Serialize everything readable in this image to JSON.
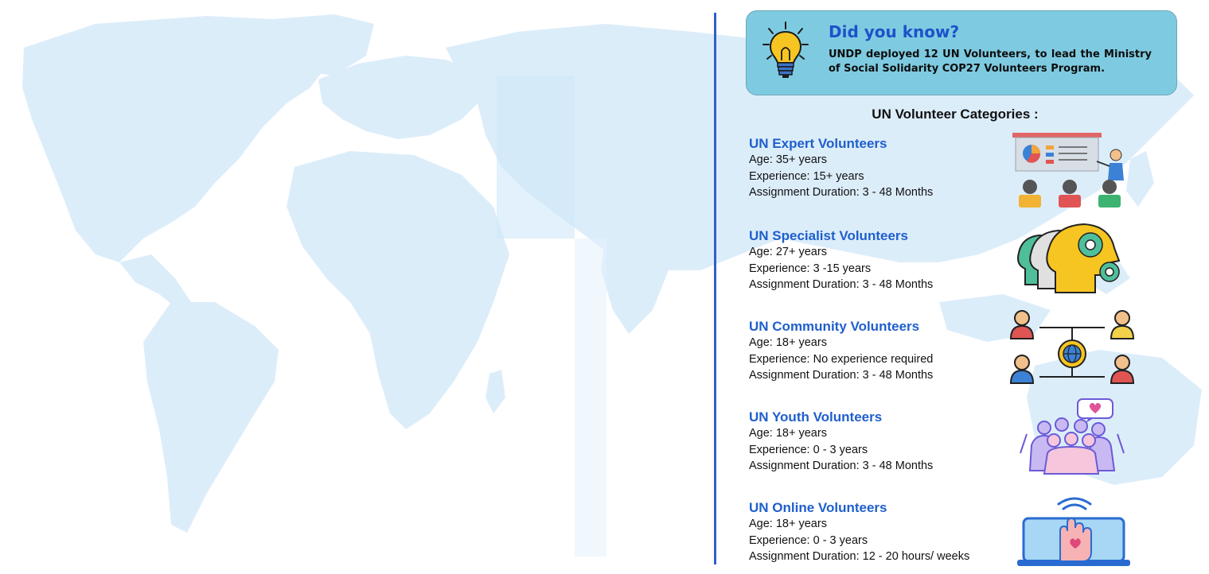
{
  "info_card": {
    "title": "Did you know?",
    "text": "UNDP deployed 12 UN Volunteers, to lead the Ministry of Social Solidarity COP27 Volunteers Program.",
    "icon": "lightbulb-icon"
  },
  "categories_heading": "UN Volunteer Categories :",
  "categories": [
    {
      "title": "UN Expert Volunteers",
      "age": "Age: 35+ years",
      "experience": "Experience:  15+ years",
      "duration": "Assignment Duration:  3 - 48 Months",
      "icon": "presentation-icon"
    },
    {
      "title": "UN Specialist Volunteers",
      "age": "Age: 27+ years",
      "experience": "Experience: 3 -15 years",
      "duration": "Assignment Duration:  3 - 48 Months",
      "icon": "heads-gears-icon"
    },
    {
      "title": "UN Community Volunteers",
      "age": "Age: 18+ years",
      "experience": "Experience: No experience required",
      "duration": "Assignment Duration:  3 - 48 Months",
      "icon": "global-network-icon"
    },
    {
      "title": "UN Youth Volunteers",
      "age": "Age: 18+ years",
      "experience": "Experience: 0 - 3 years",
      "duration": "Assignment Duration: 3 - 48 Months",
      "icon": "youth-group-heart-icon"
    },
    {
      "title": "UN Online Volunteers",
      "age": "Age: 18+ years",
      "experience": "Experience: 0 - 3 years",
      "duration": "Assignment Duration: 12 - 20 hours/ weeks",
      "icon": "laptop-hand-icon"
    }
  ],
  "colors": {
    "accent_blue": "#1f5fcc",
    "card_bg": "#7ecbe1",
    "map_fill": "#dbeefb",
    "divider": "#2f5fc9"
  }
}
